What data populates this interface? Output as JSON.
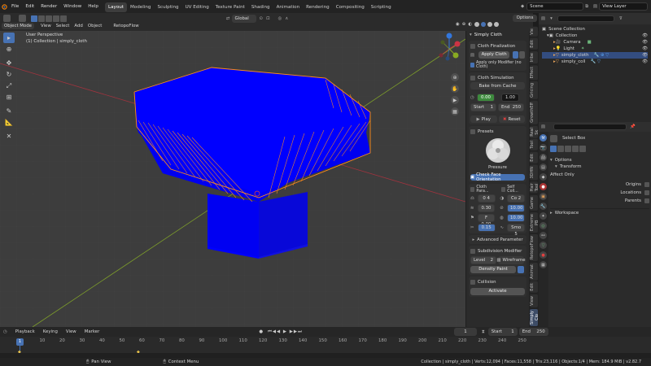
{
  "menu": [
    "File",
    "Edit",
    "Render",
    "Window",
    "Help"
  ],
  "workspaces": [
    "Layout",
    "Modeling",
    "Sculpting",
    "UV Editing",
    "Texture Paint",
    "Shading",
    "Animation",
    "Rendering",
    "Compositing",
    "Scripting"
  ],
  "scene": "Scene",
  "view_layer": "View Layer",
  "header": {
    "mode": "Object Mode",
    "view": "View",
    "select": "Select",
    "add": "Add",
    "object": "Object",
    "orientation": "Global",
    "addon": "RetopoFlow",
    "options": "Options"
  },
  "viewport": {
    "title": "User Perspective",
    "subtitle": "(1) Collection | simply_cloth"
  },
  "gizmo": {
    "x": "X",
    "y": "Y",
    "z": "Z"
  },
  "npanel": {
    "title": "Simply Cloth",
    "finalization": "Cloth Finalization",
    "apply_cloth": "Apply Cloth",
    "apply_modifier": "Apply only Modifier (no Cloth)",
    "simulation": "Cloth Simulation",
    "bake": "Bake from Cache",
    "time_a": "0.00",
    "time_b": "1.00",
    "start_label": "Start",
    "start_val": "1",
    "end_label": "End",
    "end_val": "250",
    "play": "Play",
    "reset": "Reset",
    "presets": "Presets",
    "preset_name": "Pressure",
    "check_face": "Check Face Orientation",
    "cloth_params": "Cloth Para...",
    "self_coll": "Self Coll...",
    "p1": "0 4",
    "p2": "Co 2",
    "p3": "0.30",
    "p4": "10.00",
    "p5": "F 0.00",
    "p6": "10.00",
    "p7": "0.15",
    "p8": "Smo 5",
    "advanced": "Advanced Parameter",
    "subdiv": "Subdivision Modifier",
    "level_label": "Level",
    "level_val": "2",
    "wireframe": "Wireframe",
    "density": "Density Paint",
    "collision": "Collision",
    "activate": "Activate"
  },
  "vtabs": [
    "Simply Clo",
    "View",
    "Edit",
    "Animat",
    "RetopoFlow",
    "Extreme PB",
    "Game",
    "Hair Tool",
    "3DHN",
    "Edit",
    "Tool",
    "Real Sk",
    "GrowthEff",
    "Gricing",
    "Effect",
    "Iribe",
    "Edit",
    "Vie"
  ],
  "outliner": {
    "root": "Scene Collection",
    "collection": "Collection",
    "items": [
      "Camera",
      "Light",
      "simply_cloth",
      "simply_coll"
    ]
  },
  "props": {
    "tool": "Select Box",
    "options": "Options",
    "transform": "Transform",
    "affect_only": "Affect Only",
    "origins": "Origins",
    "locations": "Locations",
    "parents": "Parents",
    "workspace": "Workspace"
  },
  "timeline": {
    "playback": "Playback",
    "keying": "Keying",
    "view": "View",
    "marker": "Marker",
    "frame": "1",
    "start_label": "Start",
    "start": "1",
    "end_label": "End",
    "end": "250",
    "ticks": [
      "1",
      "10",
      "20",
      "30",
      "40",
      "50",
      "60",
      "70",
      "80",
      "90",
      "100",
      "110",
      "120",
      "130",
      "140",
      "150",
      "160",
      "170",
      "180",
      "190",
      "200",
      "210",
      "220",
      "230",
      "240",
      "250"
    ]
  },
  "status": {
    "pan": "Pan View",
    "context": "Context Menu",
    "info": "Collection | simply_cloth | Verts:12,094 | Faces:11,558 | Tris:23,116 | Objects:1/4 | Mem: 184.9 MiB | v2.82.7"
  },
  "colors": {
    "accent": "#4772b3",
    "mesh": "#0000ff",
    "selected": "#ff8c1a",
    "x_axis": "#cc3344",
    "y_axis": "#88aa22",
    "z_axis": "#3377dd"
  }
}
